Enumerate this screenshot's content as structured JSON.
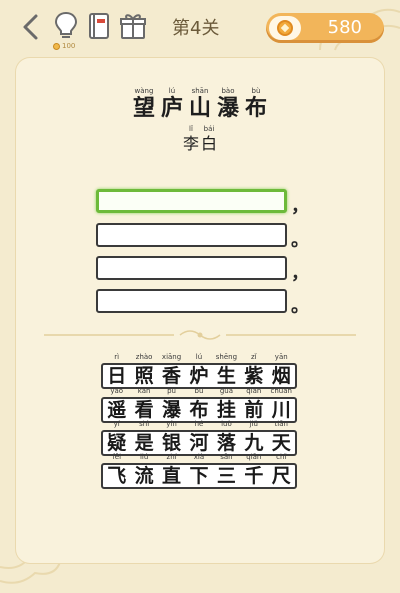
{
  "header": {
    "level_label": "第4关",
    "hint_cost": "100",
    "coins": "580"
  },
  "poem": {
    "title": [
      {
        "py": "wàng",
        "ch": "望"
      },
      {
        "py": "lú",
        "ch": "庐"
      },
      {
        "py": "shān",
        "ch": "山"
      },
      {
        "py": "bào",
        "ch": "瀑"
      },
      {
        "py": "bù",
        "ch": "布"
      }
    ],
    "author": [
      {
        "py": "lǐ",
        "ch": "李"
      },
      {
        "py": "bái",
        "ch": "白"
      }
    ]
  },
  "answers": {
    "punctuation": [
      "，",
      "。",
      "，",
      "。"
    ]
  },
  "grid": [
    [
      {
        "py": "rì",
        "ch": "日"
      },
      {
        "py": "zhào",
        "ch": "照"
      },
      {
        "py": "xiāng",
        "ch": "香"
      },
      {
        "py": "lú",
        "ch": "炉"
      },
      {
        "py": "shēng",
        "ch": "生"
      },
      {
        "py": "zǐ",
        "ch": "紫"
      },
      {
        "py": "yān",
        "ch": "烟"
      }
    ],
    [
      {
        "py": "yáo",
        "ch": "遥"
      },
      {
        "py": "kàn",
        "ch": "看"
      },
      {
        "py": "pù",
        "ch": "瀑"
      },
      {
        "py": "bù",
        "ch": "布"
      },
      {
        "py": "guà",
        "ch": "挂"
      },
      {
        "py": "qián",
        "ch": "前"
      },
      {
        "py": "chuān",
        "ch": "川"
      }
    ],
    [
      {
        "py": "yí",
        "ch": "疑"
      },
      {
        "py": "shì",
        "ch": "是"
      },
      {
        "py": "yín",
        "ch": "银"
      },
      {
        "py": "hé",
        "ch": "河"
      },
      {
        "py": "luò",
        "ch": "落"
      },
      {
        "py": "jiǔ",
        "ch": "九"
      },
      {
        "py": "tiān",
        "ch": "天"
      }
    ],
    [
      {
        "py": "fēi",
        "ch": "飞"
      },
      {
        "py": "liú",
        "ch": "流"
      },
      {
        "py": "zhí",
        "ch": "直"
      },
      {
        "py": "xià",
        "ch": "下"
      },
      {
        "py": "sān",
        "ch": "三"
      },
      {
        "py": "qiān",
        "ch": "千"
      },
      {
        "py": "chǐ",
        "ch": "尺"
      }
    ]
  ],
  "colors": {
    "background": "#F4EBCF",
    "card": "#F9F2DC",
    "coin_pill": "#F2B55A",
    "active_slot": "#6DBA3A"
  }
}
